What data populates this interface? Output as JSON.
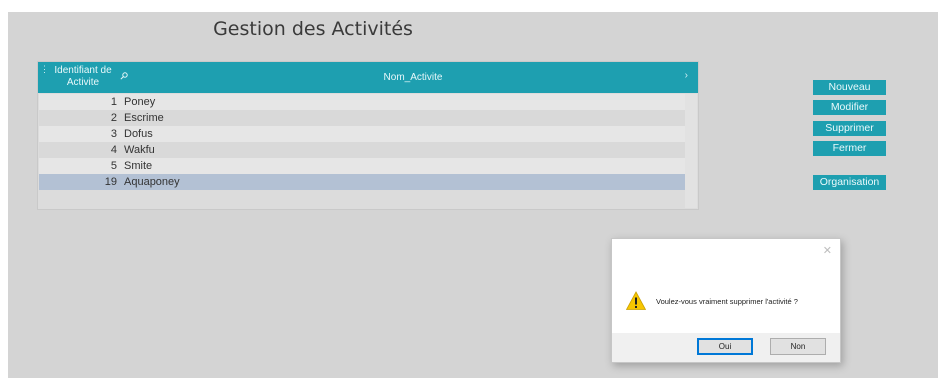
{
  "window": {
    "title": "Gestion des Activités"
  },
  "grid": {
    "columns": [
      "Identifiant de Activite",
      "Nom_Activite"
    ],
    "rows": [
      {
        "id": "1",
        "name": "Poney"
      },
      {
        "id": "2",
        "name": "Escrime"
      },
      {
        "id": "3",
        "name": "Dofus"
      },
      {
        "id": "4",
        "name": "Wakfu"
      },
      {
        "id": "5",
        "name": "Smite"
      },
      {
        "id": "19",
        "name": "Aquaponey",
        "selected": true
      }
    ]
  },
  "buttons": {
    "nouveau": "Nouveau",
    "modifier": "Modifier",
    "supprimer": "Supprimer",
    "fermer": "Fermer",
    "organisation": "Organisation"
  },
  "dialog": {
    "message": "Voulez-vous vraiment supprimer l'activité ?",
    "yes": "Oui",
    "no": "Non",
    "icon": "warning-icon"
  },
  "colors": {
    "accent": "#1e9fb0",
    "selected_row": "#b3c1d4",
    "background": "#d4d4d4"
  }
}
